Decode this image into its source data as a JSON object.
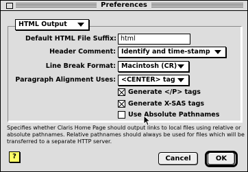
{
  "window": {
    "title": "Preferences"
  },
  "section_popup": {
    "value": "HTML Output"
  },
  "form": {
    "suffix_label": "Default HTML File Suffix:",
    "suffix_value": "html",
    "header_label": "Header Comment:",
    "header_value": "Identify and time-stamp",
    "linebreak_label": "Line Break Format:",
    "linebreak_value": "Macintosh (CR)",
    "align_label": "Paragraph Alignment Uses:",
    "align_value": "<CENTER> tag"
  },
  "options": [
    {
      "label": "Generate </P> tags",
      "checked": true
    },
    {
      "label": "Generate X-SAS tags",
      "checked": true
    },
    {
      "label": "Use Absolute Pathnames",
      "checked": false
    }
  ],
  "help_text": "Specifies whether Claris Home Page should output links to local files using relative or absolute pathnames. Relative pathnames should always be used for files which will be transferred to a separate HTTP server.",
  "buttons": {
    "help": "?",
    "cancel": "Cancel",
    "ok": "OK"
  }
}
